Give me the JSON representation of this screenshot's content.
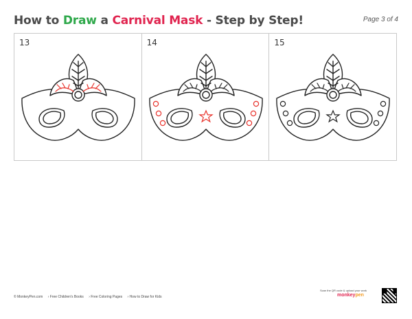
{
  "title": {
    "part1": "How to ",
    "part2": "Draw",
    "part3": " a ",
    "part4": "Carnival Mask",
    "part5": " - Step by Step!"
  },
  "page_label": "Page 3 of 4",
  "steps": [
    {
      "number": "13"
    },
    {
      "number": "14"
    },
    {
      "number": "15"
    }
  ],
  "footer": {
    "copyright": "© MonkeyPen.com",
    "link1": "› Free Children's Books",
    "link2": "› Free Coloring Pages",
    "link3": "› How to Draw for Kids"
  },
  "brand": {
    "scan_text": "Scan the QR code & upload your work",
    "name_part1": "monkey",
    "name_part2": "pen"
  },
  "colors": {
    "green": "#2ea84a",
    "red": "#e0244f",
    "highlight": "#e8322b"
  }
}
